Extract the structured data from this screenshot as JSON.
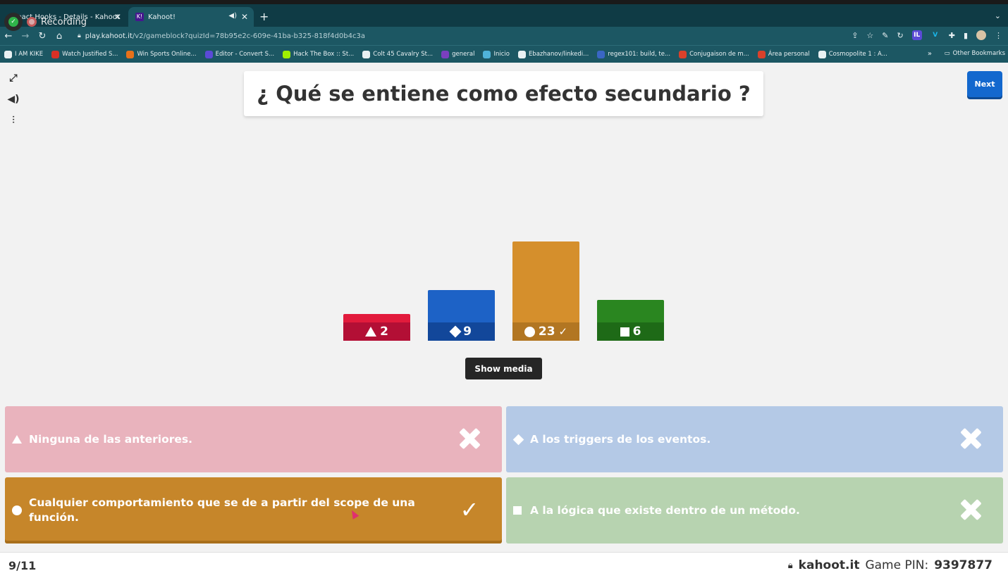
{
  "browser": {
    "tabs": [
      {
        "title": "React Hooks - Details - Kahoot",
        "active": false
      },
      {
        "title": "Kahoot!",
        "active": true
      }
    ],
    "recording_label": "Recording",
    "url_host": "play.kahoot.it",
    "url_path": "/v2/gameblock?quizId=78b95e2c-609e-41ba-b325-818f4d0b4c3a",
    "bookmarks": [
      {
        "label": "I AM KIKE",
        "color": "#e9f1f3"
      },
      {
        "label": "Watch Justified S...",
        "color": "#d93025"
      },
      {
        "label": "Win Sports Online...",
        "color": "#e8711a"
      },
      {
        "label": "Editor - Convert S...",
        "color": "#5b4ad6"
      },
      {
        "label": "Hack The Box :: St...",
        "color": "#9fef00"
      },
      {
        "label": "Colt 45 Cavalry St...",
        "color": "#e9f1f3"
      },
      {
        "label": "general",
        "color": "#7b3fbf"
      },
      {
        "label": "Inicio",
        "color": "#4fb3d9"
      },
      {
        "label": "Ebazhanov/linkedi...",
        "color": "#e9f1f3"
      },
      {
        "label": "regex101: build, te...",
        "color": "#3a66c4"
      },
      {
        "label": "Conjugaison de m...",
        "color": "#d9412b"
      },
      {
        "label": "Área personal",
        "color": "#d9412b"
      },
      {
        "label": "Cosmopolite 1 : A...",
        "color": "#e9f1f3"
      }
    ],
    "bookmarks_more": "»",
    "other_bookmarks": "Other Bookmarks"
  },
  "quiz": {
    "question": "¿ Qué se entiene como efecto secundario ?",
    "next_label": "Next",
    "show_media_label": "Show media",
    "results": [
      {
        "shape": "triangle",
        "count": "2",
        "color": "#e21b3c",
        "correct": false
      },
      {
        "shape": "diamond",
        "count": "9",
        "color": "#1368ce",
        "correct": false
      },
      {
        "shape": "circle",
        "count": "23",
        "color": "#d89e00",
        "correct": true
      },
      {
        "shape": "square",
        "count": "6",
        "color": "#26890c",
        "correct": false
      }
    ],
    "answers": [
      {
        "shape": "triangle",
        "text": "Ninguna de las anteriores.",
        "color": "#e9b3bd",
        "correct": false
      },
      {
        "shape": "diamond",
        "text": "A los triggers de los eventos.",
        "color": "#b4c9e6",
        "correct": false
      },
      {
        "shape": "circle",
        "text": "Cualquier comportamiento que se de a partir del scope de una función.",
        "color": "#c6862a",
        "correct": true
      },
      {
        "shape": "square",
        "text": "A la lógica que existe dentro de un método.",
        "color": "#b7d3b0",
        "correct": false
      }
    ],
    "check_mark": "✓",
    "progress": "9/11",
    "brand": "kahoot.it",
    "game_pin_label": "Game PIN:",
    "game_pin": "9397877"
  }
}
